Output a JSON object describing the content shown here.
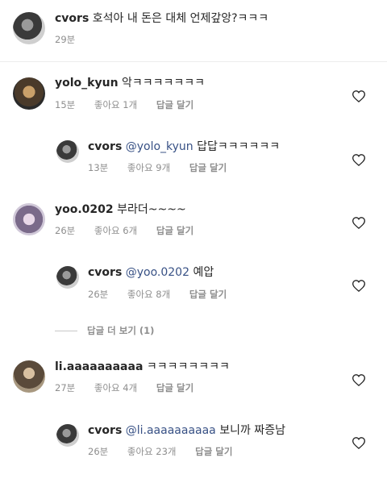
{
  "caption": {
    "username": "cvors",
    "text": "호석아 내 돈은 대체 언제갚앙?ㅋㅋㅋ",
    "time": "29분"
  },
  "comments": [
    {
      "username": "yolo_kyun",
      "mention": "",
      "text": "악ㅋㅋㅋㅋㅋㅋㅋ",
      "time": "15분",
      "likes": "좋아요 1개",
      "reply_label": "답글 달기"
    },
    {
      "username": "cvors",
      "mention": "@yolo_kyun",
      "text": "답답ㅋㅋㅋㅋㅋㅋ",
      "time": "13분",
      "likes": "좋아요 9개",
      "reply_label": "답글 달기"
    },
    {
      "username": "yoo.0202",
      "mention": "",
      "text": "부라더~~~~",
      "time": "26분",
      "likes": "좋아요 6개",
      "reply_label": "답글 달기"
    },
    {
      "username": "cvors",
      "mention": "@yoo.0202",
      "text": "예압",
      "time": "26분",
      "likes": "좋아요 8개",
      "reply_label": "답글 달기"
    },
    {
      "username": "li.aaaaaaaaaa",
      "mention": "",
      "text": "ㅋㅋㅋㅋㅋㅋㅋㅋ",
      "time": "27분",
      "likes": "좋아요 4개",
      "reply_label": "답글 달기"
    },
    {
      "username": "cvors",
      "mention": "@li.aaaaaaaaaa",
      "text": "보니까 짜증남",
      "time": "26분",
      "likes": "좋아요 23개",
      "reply_label": "답글 달기"
    }
  ],
  "view_more_replies": "답글 더 보기 (1)",
  "icons": {
    "like": "heart-outline-icon"
  },
  "colors": {
    "mention": "#385185",
    "meta": "#8e8e8e"
  }
}
